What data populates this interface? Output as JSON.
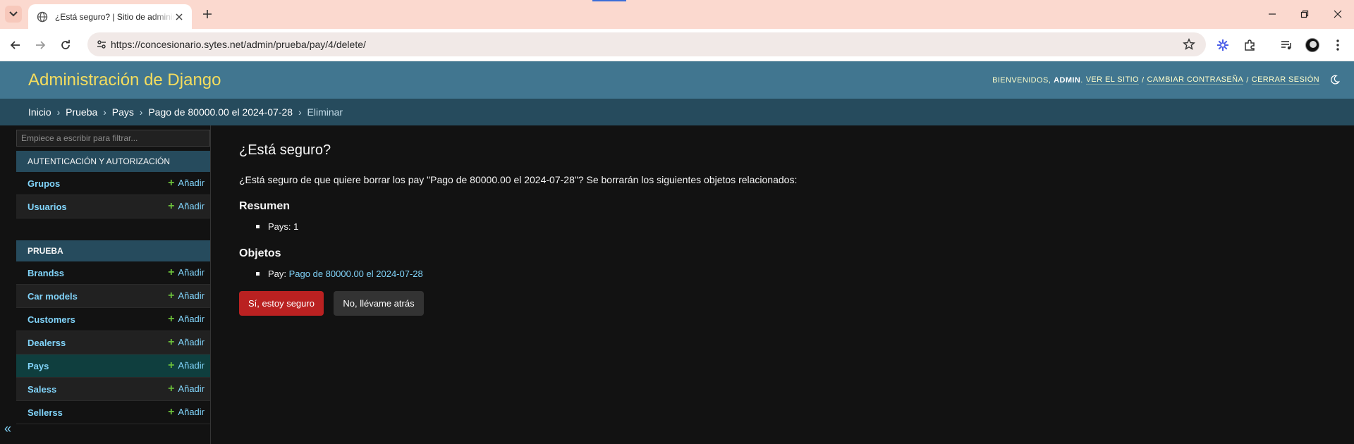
{
  "browser": {
    "tab_title": "¿Está seguro? | Sitio de administración de Django",
    "url": "https://concesionario.sytes.net/admin/prueba/pay/4/delete/"
  },
  "header": {
    "site_name": "Administración de Django",
    "welcome": "Bienvenidos,",
    "user": "admin",
    "view_site": "Ver el sitio",
    "change_password": "Cambiar contraseña",
    "logout": "Cerrar sesión",
    "separator": "/"
  },
  "breadcrumbs": {
    "home": "Inicio",
    "app": "Prueba",
    "model": "Pays",
    "object": "Pago de 80000.00 el 2024-07-28",
    "current": "Eliminar",
    "sep": "›"
  },
  "sidebar": {
    "filter_placeholder": "Empiece a escribir para filtrar...",
    "add_label": "Añadir",
    "modules": [
      {
        "caption": "Autenticación y autorización",
        "models": [
          "Grupos",
          "Usuarios"
        ]
      },
      {
        "caption": "Prueba",
        "models": [
          "Brandss",
          "Car models",
          "Customers",
          "Dealerss",
          "Pays",
          "Saless",
          "Sellerss"
        ]
      }
    ],
    "current_model": "Pays",
    "collapse_glyph": "«"
  },
  "content": {
    "title": "¿Está seguro?",
    "question": "¿Está seguro de que quiere borrar los pay \"Pago de 80000.00 el 2024-07-28\"? Se borrarán los siguientes objetos relacionados:",
    "summary_heading": "Resumen",
    "summary_item": "Pays: 1",
    "objects_heading": "Objetos",
    "object_prefix": "Pay:",
    "object_link": "Pago de 80000.00 el 2024-07-28",
    "confirm_button": "Sí, estoy seguro",
    "cancel_button": "No, llévame atrás"
  },
  "colors": {
    "header_bg": "#417690",
    "breadcrumbs_bg": "#264b5d",
    "branding": "#f5dd5d",
    "link": "#81d4fa",
    "danger": "#ba2121"
  }
}
